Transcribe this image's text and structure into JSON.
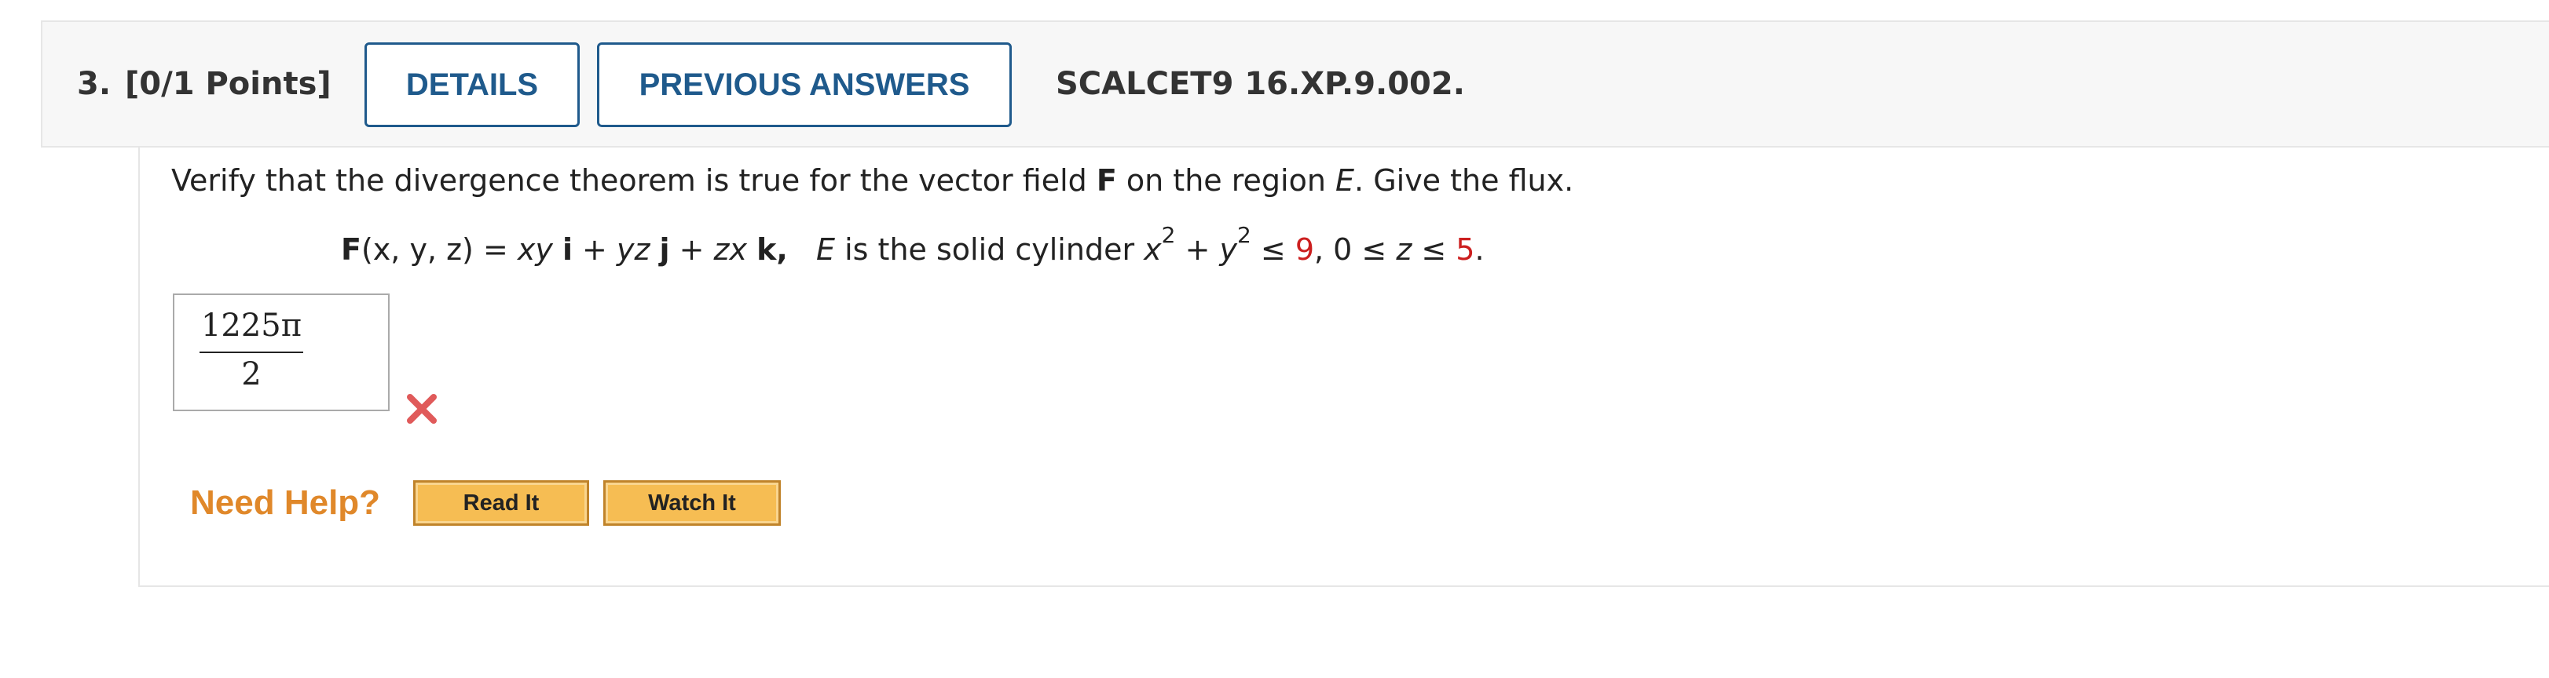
{
  "header": {
    "question_number": "3.",
    "points": "[0/1 Points]",
    "details_label": "DETAILS",
    "previous_answers_label": "PREVIOUS ANSWERS",
    "question_code": "SCALCET9 16.XP.9.002."
  },
  "question": {
    "prompt_part1": "Verify that the divergence theorem is true for the vector field ",
    "prompt_F": "F",
    "prompt_part2": " on the region ",
    "prompt_E": "E",
    "prompt_part3": ". Give the flux.",
    "formula": {
      "F_bold": "F",
      "args": "(x, y, z)",
      "eq": " = ",
      "t1": "xy",
      "i": "i",
      "plus1": " + ",
      "t2": "yz",
      "j": "j",
      "plus2": " + ",
      "t3": "zx",
      "k": "k",
      "comma": ",",
      "E": "E",
      "region_text": " is the solid cylinder ",
      "x": "x",
      "exp1": "2",
      "plus3": " + ",
      "y": "y",
      "exp2": "2",
      "le1": " ≤ ",
      "radius_sq": "9",
      "mid": ", 0 ≤ ",
      "z": "z",
      "le2": " ≤ ",
      "height": "5",
      "end": "."
    }
  },
  "answer": {
    "numerator": "1225π",
    "denominator": "2",
    "status_icon": "x-mark-icon",
    "status": "incorrect"
  },
  "help": {
    "label": "Need Help?",
    "read_it": "Read It",
    "watch_it": "Watch It"
  },
  "colors": {
    "accent": "#1f5a8c",
    "error": "#e05a5a",
    "help_orange": "#e0882a",
    "help_button": "#f6bd53"
  }
}
